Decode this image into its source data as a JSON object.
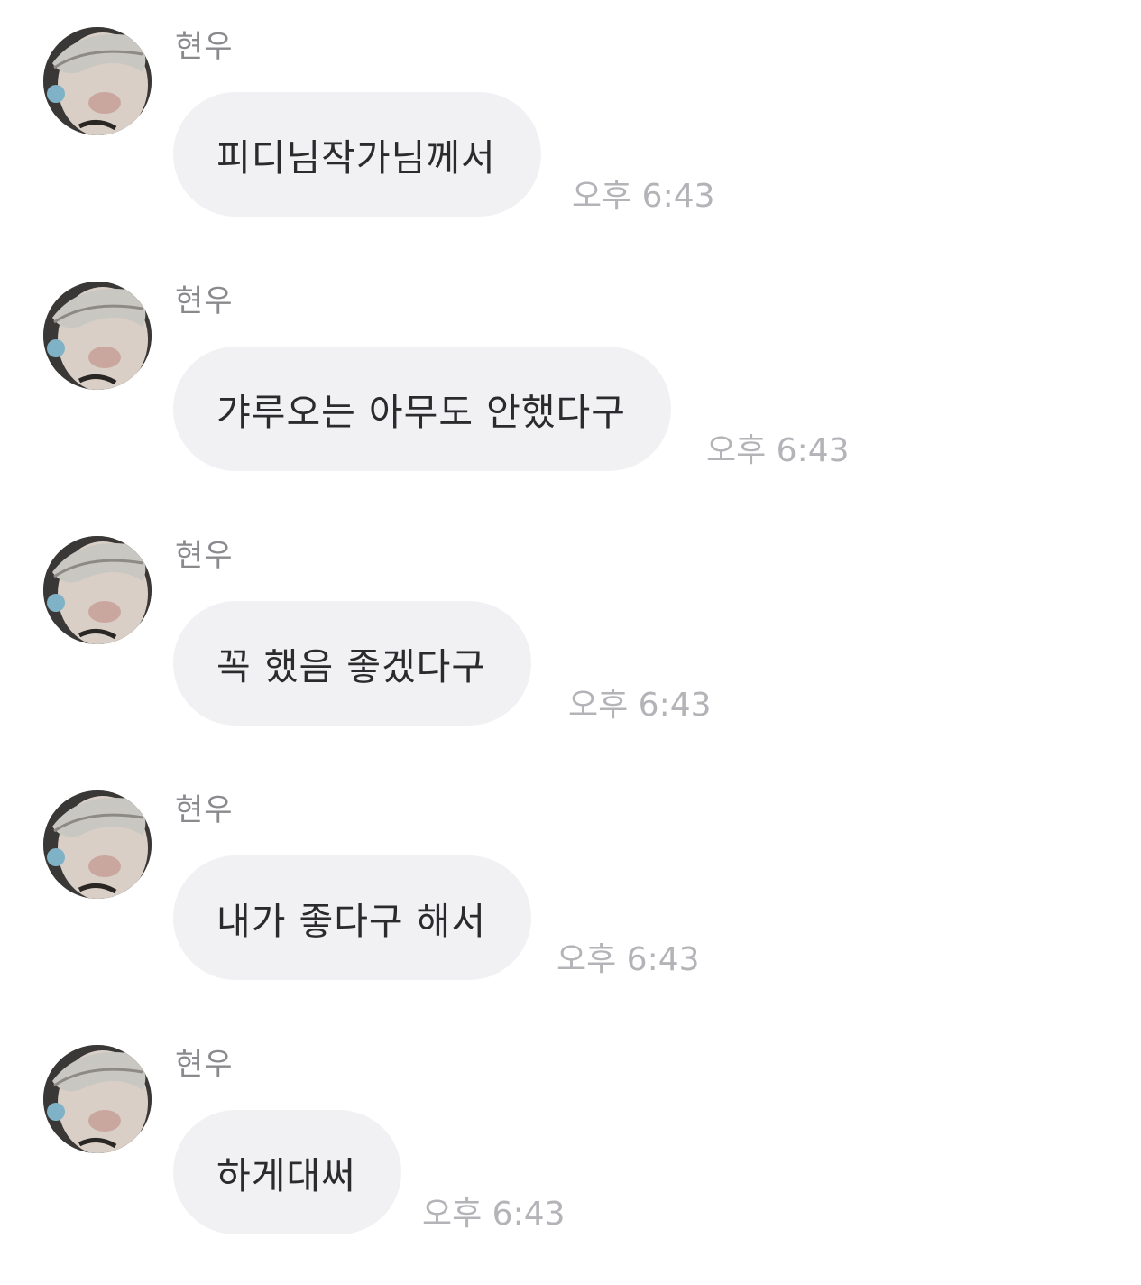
{
  "messages": [
    {
      "sender": "현우",
      "text": "피디님작가님께서",
      "time": "오후 6:43",
      "avatar_icon": "profile-photo"
    },
    {
      "sender": "현우",
      "text": "갸루오는 아무도 안했다구",
      "time": "오후 6:43",
      "avatar_icon": "profile-photo"
    },
    {
      "sender": "현우",
      "text": "꼭 했음 좋겠다구",
      "time": "오후 6:43",
      "avatar_icon": "profile-photo"
    },
    {
      "sender": "현우",
      "text": "내가 좋다구 해서",
      "time": "오후 6:43",
      "avatar_icon": "profile-photo"
    },
    {
      "sender": "현우",
      "text": "하게대써",
      "time": "오후 6:43",
      "avatar_icon": "profile-photo"
    }
  ],
  "colors": {
    "bubble": "#f1f1f4",
    "text": "#2b2b2e",
    "sender": "#8a8a8e",
    "time": "#b3b3b8"
  }
}
